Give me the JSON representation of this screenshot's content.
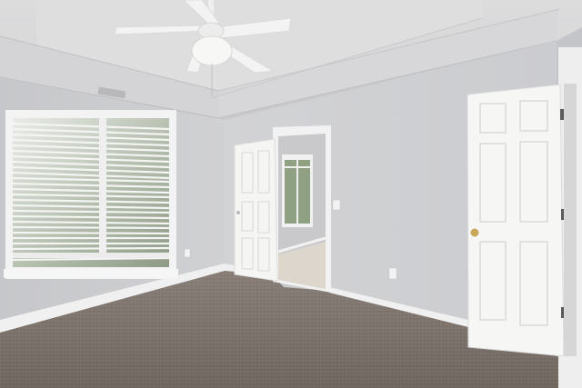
{
  "scene": {
    "description_tags": [
      "ceiling-fan",
      "tray-ceiling",
      "window-with-blinds",
      "open-door",
      "closet-door",
      "carpet-floor",
      "baseboard",
      "outlet"
    ],
    "colors": {
      "wall": "#cfd0d2",
      "wall_shadow": "#c2c3c6",
      "ceiling": "#d9d9da",
      "carpet": "#7d736c",
      "trim": "#f2f2f2",
      "door": "#f4f4f3",
      "hallway_floor": "#dcd6cc"
    }
  }
}
